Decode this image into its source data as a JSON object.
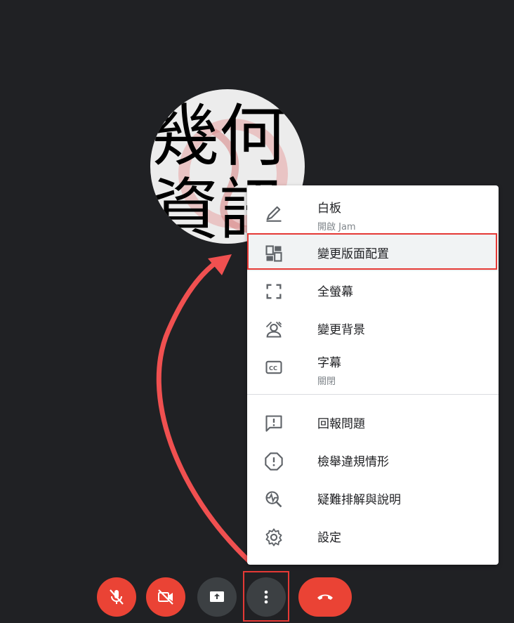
{
  "avatar": {
    "logo_text": "幾何資訊"
  },
  "menu": {
    "items": [
      {
        "label": "白板",
        "sublabel": "開啟 Jam",
        "icon": "pencil-icon"
      },
      {
        "label": "變更版面配置",
        "icon": "layout-icon"
      },
      {
        "label": "全螢幕",
        "icon": "fullscreen-icon"
      },
      {
        "label": "變更背景",
        "icon": "background-icon"
      },
      {
        "label": "字幕",
        "sublabel": "關閉",
        "icon": "closed-caption-icon"
      },
      {
        "label": "回報問題",
        "icon": "feedback-icon"
      },
      {
        "label": "檢舉違規情形",
        "icon": "report-icon"
      },
      {
        "label": "疑難排解與說明",
        "icon": "troubleshoot-icon"
      },
      {
        "label": "設定",
        "icon": "gear-icon"
      }
    ]
  },
  "controls": {
    "mic": {
      "icon": "mic-off-icon",
      "color": "#ea4335"
    },
    "camera": {
      "icon": "camera-off-icon",
      "color": "#ea4335"
    },
    "present": {
      "icon": "present-screen-icon",
      "color": "#3c4043"
    },
    "more": {
      "icon": "more-vert-icon",
      "color": "#3c4043"
    },
    "hangup": {
      "icon": "hangup-icon",
      "color": "#ea4335"
    }
  },
  "annotation": {
    "color": "#e53935"
  }
}
